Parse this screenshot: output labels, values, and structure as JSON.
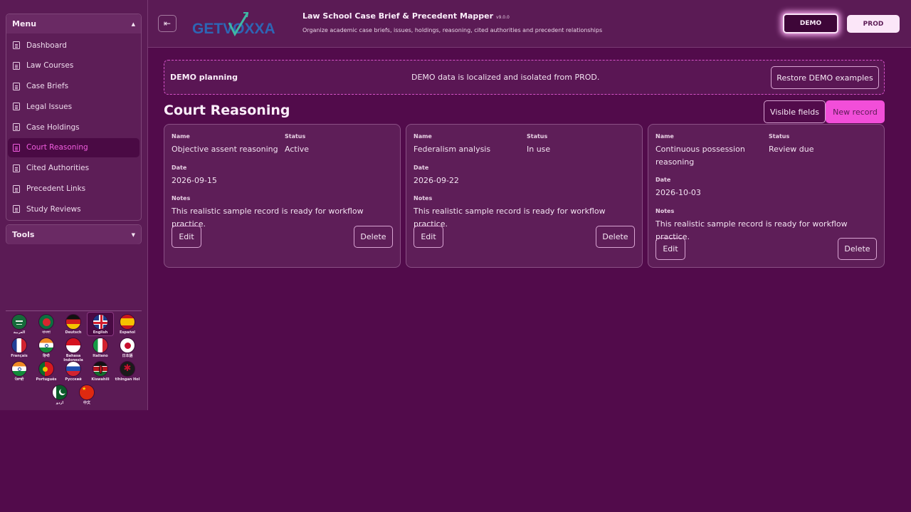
{
  "sidebar": {
    "menu_title": "Menu",
    "menu_items": [
      {
        "label": "Dashboard"
      },
      {
        "label": "Law Courses"
      },
      {
        "label": "Case Briefs"
      },
      {
        "label": "Legal Issues"
      },
      {
        "label": "Case Holdings"
      },
      {
        "label": "Court Reasoning",
        "active": true
      },
      {
        "label": "Cited Authorities"
      },
      {
        "label": "Precedent Links"
      },
      {
        "label": "Study Reviews"
      }
    ],
    "tools_title": "Tools",
    "languages": [
      {
        "name": "العربية",
        "icon": "saudi-flag-icon"
      },
      {
        "name": "বাংলা",
        "icon": "bangladesh-flag-icon"
      },
      {
        "name": "Deutsch",
        "icon": "germany-flag-icon"
      },
      {
        "name": "English",
        "icon": "uk-flag-icon",
        "selected": true
      },
      {
        "name": "Español",
        "icon": "spain-flag-icon"
      },
      {
        "name": "Français",
        "icon": "france-flag-icon"
      },
      {
        "name": "हिन्दी",
        "icon": "india-flag-icon"
      },
      {
        "name": "Bahasa Indonesia",
        "icon": "indonesia-flag-icon"
      },
      {
        "name": "Italiano",
        "icon": "italy-flag-icon"
      },
      {
        "name": "日本語",
        "icon": "japan-flag-icon"
      },
      {
        "name": "ਪੰਜਾਬੀ",
        "icon": "india-flag-icon"
      },
      {
        "name": "Português",
        "icon": "portugal-flag-icon"
      },
      {
        "name": "Русский",
        "icon": "russia-flag-icon"
      },
      {
        "name": "Kiswahili",
        "icon": "kenya-flag-icon"
      },
      {
        "name": "tlhIngan Hol",
        "icon": "klingon-emblem-icon"
      },
      {
        "name": "اردو",
        "icon": "pakistan-flag-icon"
      },
      {
        "name": "中文",
        "icon": "china-flag-icon"
      }
    ]
  },
  "header": {
    "logo_text": "GETVOXXA",
    "title": "Law School Case Brief & Precedent Mapper",
    "version": "v9.0.0",
    "subtitle": "Organize academic case briefs, issues, holdings, reasoning, cited authorities and precedent relationships",
    "env_demo": "DEMO",
    "env_prod": "PROD"
  },
  "notice": {
    "title": "DEMO planning",
    "message": "DEMO data is localized and isolated from PROD.",
    "restore_label": "Restore DEMO examples"
  },
  "section": {
    "title": "Court Reasoning",
    "visible_fields_label": "Visible fields",
    "new_record_label": "New record"
  },
  "field_labels": {
    "name": "Name",
    "status": "Status",
    "date": "Date",
    "notes": "Notes"
  },
  "actions": {
    "edit": "Edit",
    "delete": "Delete"
  },
  "records": [
    {
      "name": "Objective assent reasoning",
      "status": "Active",
      "date": "2026-09-15",
      "notes": "This realistic sample record is ready for workflow practice."
    },
    {
      "name": "Federalism analysis",
      "status": "In use",
      "date": "2026-09-22",
      "notes": "This realistic sample record is ready for workflow practice."
    },
    {
      "name": "Continuous possession reasoning",
      "status": "Review due",
      "date": "2026-10-03",
      "notes": "This realistic sample record is ready for workflow practice."
    }
  ],
  "colors": {
    "background": "#520b4b",
    "accent": "#f24ed9",
    "active_text": "#f25de0"
  }
}
